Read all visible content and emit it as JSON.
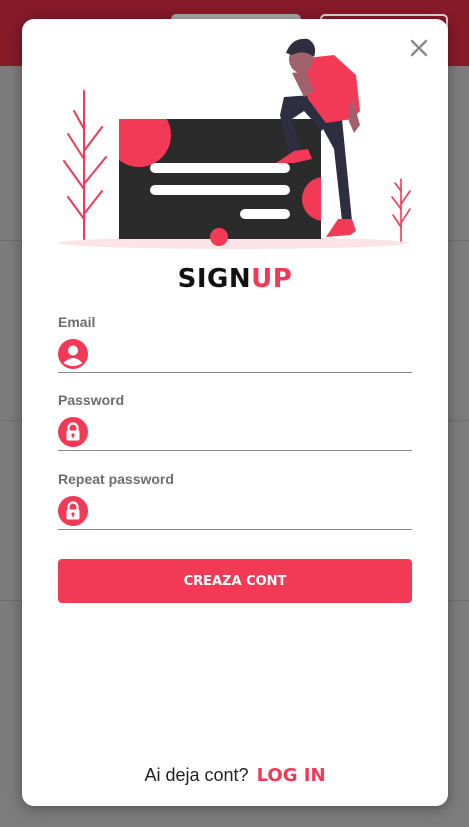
{
  "modal": {
    "title_main": "SIGN",
    "title_accent": "UP",
    "close_icon": "close-icon"
  },
  "form": {
    "email": {
      "label": "Email",
      "value": "",
      "icon": "user-icon"
    },
    "password": {
      "label": "Password",
      "value": "",
      "icon": "lock-icon"
    },
    "repeat_password": {
      "label": "Repeat password",
      "value": "",
      "icon": "lock-icon"
    },
    "submit_label": "CREAZA CONT"
  },
  "footer": {
    "prompt": "Ai deja cont?",
    "login_label": "LOG IN"
  },
  "colors": {
    "accent": "#f23a57",
    "header_bg": "#861a29",
    "overlay": "#7c7c7c",
    "dark": "#2f2e41"
  }
}
